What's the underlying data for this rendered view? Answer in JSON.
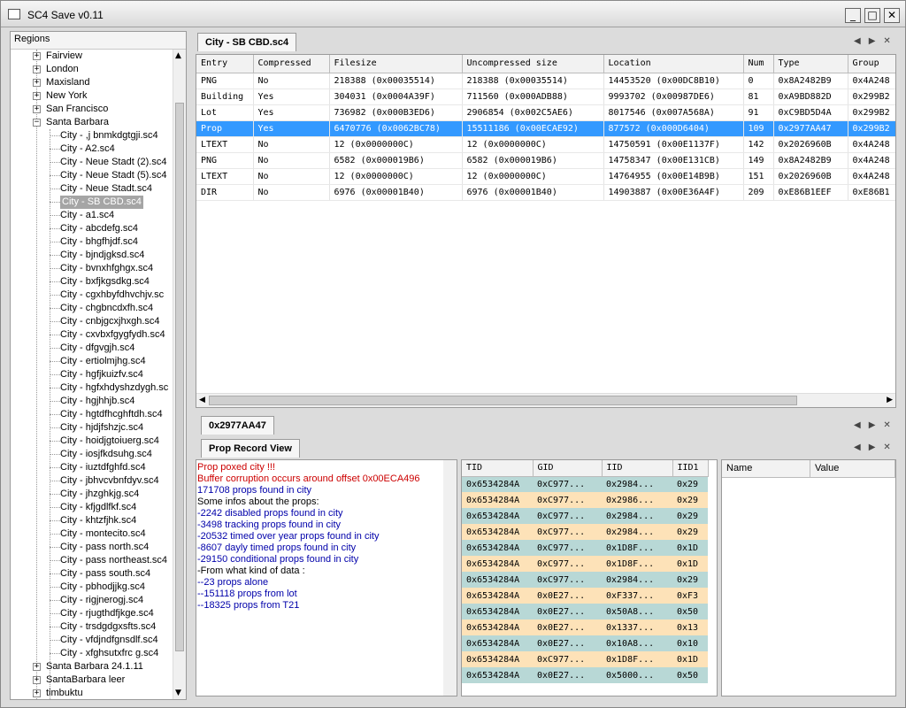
{
  "window": {
    "title": "SC4 Save v0.11",
    "min": "_",
    "max": "□",
    "close": "✕"
  },
  "regions": {
    "header": "Regions",
    "items": [
      {
        "label": "Fairview",
        "type": "region",
        "exp": "+"
      },
      {
        "label": "London",
        "type": "region",
        "exp": "+"
      },
      {
        "label": "Maxisland",
        "type": "region",
        "exp": "+"
      },
      {
        "label": "New York",
        "type": "region",
        "exp": "+"
      },
      {
        "label": "San Francisco",
        "type": "region",
        "exp": "+"
      },
      {
        "label": "Santa Barbara",
        "type": "region",
        "exp": "−"
      },
      {
        "label": "City - ,j bnmkdgtgji.sc4",
        "type": "city"
      },
      {
        "label": "City - A2.sc4",
        "type": "city"
      },
      {
        "label": "City - Neue Stadt (2).sc4",
        "type": "city"
      },
      {
        "label": "City - Neue Stadt (5).sc4",
        "type": "city"
      },
      {
        "label": "City - Neue Stadt.sc4",
        "type": "city"
      },
      {
        "label": "City - SB CBD.sc4",
        "type": "city",
        "selected": true
      },
      {
        "label": "City - a1.sc4",
        "type": "city"
      },
      {
        "label": "City - abcdefg.sc4",
        "type": "city"
      },
      {
        "label": "City - bhgfhjdf.sc4",
        "type": "city"
      },
      {
        "label": "City - bjndjgksd.sc4",
        "type": "city"
      },
      {
        "label": "City - bvnxhfghgx.sc4",
        "type": "city"
      },
      {
        "label": "City - bxfjkgsdkg.sc4",
        "type": "city"
      },
      {
        "label": "City - cgxhbyfdhvchjv.sc",
        "type": "city"
      },
      {
        "label": "City - chgbncdxfh.sc4",
        "type": "city"
      },
      {
        "label": "City - cnbjgcxjhxgh.sc4",
        "type": "city"
      },
      {
        "label": "City - cxvbxfgygfydh.sc4",
        "type": "city"
      },
      {
        "label": "City - dfgvgjh.sc4",
        "type": "city"
      },
      {
        "label": "City - ertiolmjhg.sc4",
        "type": "city"
      },
      {
        "label": "City - hgfjkuizfv.sc4",
        "type": "city"
      },
      {
        "label": "City - hgfxhdyshzdygh.sc",
        "type": "city"
      },
      {
        "label": "City - hgjhhjb.sc4",
        "type": "city"
      },
      {
        "label": "City - hgtdfhcghftdh.sc4",
        "type": "city"
      },
      {
        "label": "City - hjdjfshzjc.sc4",
        "type": "city"
      },
      {
        "label": "City - hoidjgtoiuerg.sc4",
        "type": "city"
      },
      {
        "label": "City - iosjfkdsuhg.sc4",
        "type": "city"
      },
      {
        "label": "City - iuztdfghfd.sc4",
        "type": "city"
      },
      {
        "label": "City - jbhvcvbnfdyv.sc4",
        "type": "city"
      },
      {
        "label": "City - jhzghkjg.sc4",
        "type": "city"
      },
      {
        "label": "City - kfjgdlfkf.sc4",
        "type": "city"
      },
      {
        "label": "City - khtzfjhk.sc4",
        "type": "city"
      },
      {
        "label": "City - montecito.sc4",
        "type": "city"
      },
      {
        "label": "City - pass north.sc4",
        "type": "city"
      },
      {
        "label": "City - pass northeast.sc4",
        "type": "city"
      },
      {
        "label": "City - pass south.sc4",
        "type": "city"
      },
      {
        "label": "City - pbhodjjkg.sc4",
        "type": "city"
      },
      {
        "label": "City - rigjnerogj.sc4",
        "type": "city"
      },
      {
        "label": "City - rjugthdfjkge.sc4",
        "type": "city"
      },
      {
        "label": "City - trsdgdgxsfts.sc4",
        "type": "city"
      },
      {
        "label": "City - vfdjndfgnsdlf.sc4",
        "type": "city"
      },
      {
        "label": "City - xfghsutxfrc g.sc4",
        "type": "city"
      },
      {
        "label": "Santa Barbara 24.1.11",
        "type": "region",
        "exp": "+"
      },
      {
        "label": "SantaBarbara leer",
        "type": "region",
        "exp": "+"
      },
      {
        "label": "timbuktu",
        "type": "region",
        "exp": "+"
      }
    ]
  },
  "top_tab": "City - SB CBD.sc4",
  "entries": {
    "columns": [
      "Entry",
      "Compressed",
      "Filesize",
      "Uncompressed size",
      "Location",
      "Num",
      "Type",
      "Group"
    ],
    "rows": [
      [
        "PNG",
        "No",
        "218388 (0x00035514)",
        "218388 (0x00035514)",
        "14453520 (0x00DC8B10)",
        "0",
        "0x8A2482B9",
        "0x4A248"
      ],
      [
        "Building",
        "Yes",
        "304031 (0x0004A39F)",
        "711560 (0x000ADB88)",
        "9993702 (0x00987DE6)",
        "81",
        "0xA9BD882D",
        "0x299B2"
      ],
      [
        "Lot",
        "Yes",
        "736982 (0x000B3ED6)",
        "2906854 (0x002C5AE6)",
        "8017546 (0x007A568A)",
        "91",
        "0xC9BD5D4A",
        "0x299B2"
      ],
      [
        "Prop",
        "Yes",
        "6470776 (0x0062BC78)",
        "15511186 (0x00ECAE92)",
        "877572 (0x000D6404)",
        "109",
        "0x2977AA47",
        "0x299B2"
      ],
      [
        "LTEXT",
        "No",
        "12 (0x0000000C)",
        "12 (0x0000000C)",
        "14750591 (0x00E1137F)",
        "142",
        "0x2026960B",
        "0x4A248"
      ],
      [
        "PNG",
        "No",
        "6582 (0x000019B6)",
        "6582 (0x000019B6)",
        "14758347 (0x00E131CB)",
        "149",
        "0x8A2482B9",
        "0x4A248"
      ],
      [
        "LTEXT",
        "No",
        "12 (0x0000000C)",
        "12 (0x0000000C)",
        "14764955 (0x00E14B9B)",
        "151",
        "0x2026960B",
        "0x4A248"
      ],
      [
        "DIR",
        "No",
        "6976 (0x00001B40)",
        "6976 (0x00001B40)",
        "14903887 (0x00E36A4F)",
        "209",
        "0xE86B1EEF",
        "0xE86B1"
      ]
    ],
    "selected_row": 3
  },
  "bottom_tab": "0x2977AA47",
  "inner_tab": "Prop Record View",
  "log": [
    {
      "text": "Prop poxed city !!!",
      "color": "red"
    },
    {
      "text": "Buffer corruption occurs around offset 0x00ECA496",
      "color": "red"
    },
    {
      "text": "171708 props found in city",
      "color": "blue"
    },
    {
      "text": "Some infos about the props:",
      "color": "black"
    },
    {
      "text": "-2242 disabled props found in city",
      "color": "blue"
    },
    {
      "text": "-3498 tracking props found in city",
      "color": "blue"
    },
    {
      "text": "-20532 timed over year props found in city",
      "color": "blue"
    },
    {
      "text": "-8607 dayly timed props found in city",
      "color": "blue"
    },
    {
      "text": "-29150 conditional props found in city",
      "color": "blue"
    },
    {
      "text": "-From what kind of data :",
      "color": "black"
    },
    {
      "text": "--23 props alone",
      "color": "blue"
    },
    {
      "text": "--151118 props from lot",
      "color": "blue"
    },
    {
      "text": "--18325 props from T21",
      "color": "blue"
    }
  ],
  "props": {
    "columns": [
      "TID",
      "GID",
      "IID",
      "IID1"
    ],
    "rows": [
      [
        "0x6534284A",
        "0xC977...",
        "0x2984...",
        "0x29"
      ],
      [
        "0x6534284A",
        "0xC977...",
        "0x2986...",
        "0x29"
      ],
      [
        "0x6534284A",
        "0xC977...",
        "0x2984...",
        "0x29"
      ],
      [
        "0x6534284A",
        "0xC977...",
        "0x2984...",
        "0x29"
      ],
      [
        "0x6534284A",
        "0xC977...",
        "0x1D8F...",
        "0x1D"
      ],
      [
        "0x6534284A",
        "0xC977...",
        "0x1D8F...",
        "0x1D"
      ],
      [
        "0x6534284A",
        "0xC977...",
        "0x2984...",
        "0x29"
      ],
      [
        "0x6534284A",
        "0x0E27...",
        "0xF337...",
        "0xF3"
      ],
      [
        "0x6534284A",
        "0x0E27...",
        "0x50A8...",
        "0x50"
      ],
      [
        "0x6534284A",
        "0x0E27...",
        "0x1337...",
        "0x13"
      ],
      [
        "0x6534284A",
        "0x0E27...",
        "0x10A8...",
        "0x10"
      ],
      [
        "0x6534284A",
        "0xC977...",
        "0x1D8F...",
        "0x1D"
      ],
      [
        "0x6534284A",
        "0x0E27...",
        "0x5000...",
        "0x50"
      ]
    ]
  },
  "namevalue": {
    "name": "Name",
    "value": "Value"
  },
  "nav": {
    "prev": "◀",
    "next": "▶",
    "close": "✕"
  }
}
